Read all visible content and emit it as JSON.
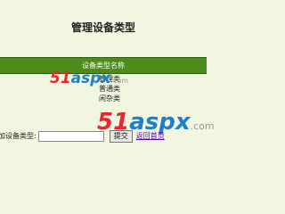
{
  "page": {
    "title": "管理设备类型"
  },
  "table": {
    "header": "设备类型名称",
    "rows": [
      "管理类",
      "普通类",
      "闲杂类"
    ]
  },
  "watermark": {
    "number": "51",
    "brand": "aspx",
    "suffix": ".com"
  },
  "add_form": {
    "label": "加设备类型:",
    "input_value": "",
    "submit_label": "提交",
    "back_link": "返回首页"
  },
  "colors": {
    "header_bg": "#4c8c1b",
    "page_bg": "#f0f6df",
    "link": "#5a00a8"
  }
}
